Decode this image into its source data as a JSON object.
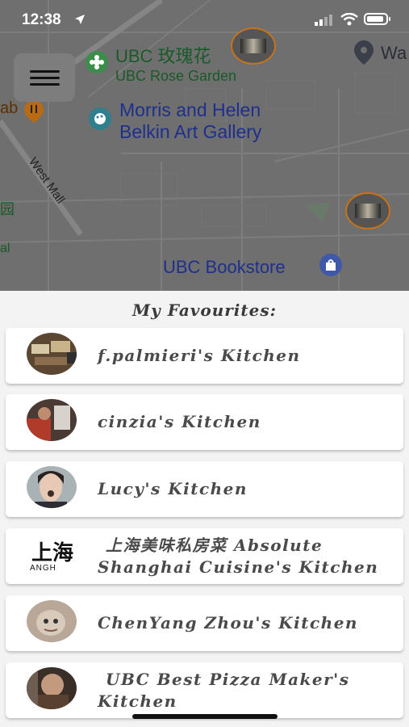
{
  "status_bar": {
    "time": "12:38"
  },
  "map": {
    "pois": {
      "rose_garden_cn": "UBC 玫瑰花",
      "rose_garden_en": "UBC Rose Garden",
      "gallery_line1": "Morris and Helen",
      "gallery_line2": "Belkin Art Gallery",
      "bookstore": "UBC Bookstore",
      "partial_right": "Wa",
      "partial_left_top": "ab",
      "partial_left_cn": "园",
      "partial_left_al": "al"
    },
    "road": "West Mall",
    "icons": {
      "menu": "hamburger-menu-icon",
      "rose_garden": "flower-pin-icon",
      "gallery": "palette-pin-icon",
      "bookstore": "shopping-bag-pin-icon",
      "pub": "food-pin-icon",
      "location": "map-pin-icon"
    }
  },
  "favourites": {
    "title": "My Favourites:",
    "items": [
      {
        "name": "f.palmieri's Kitchen"
      },
      {
        "name": "cinzia's Kitchen"
      },
      {
        "name": "Lucy's Kitchen"
      },
      {
        "name": "上海美味私房菜 Absolute Shanghai Cuisine's Kitchen",
        "avatar_text": "上海",
        "avatar_subtext": "ANGH"
      },
      {
        "name": "ChenYang Zhou's Kitchen"
      },
      {
        "name": "UBC Best Pizza Maker's Kitchen"
      }
    ]
  }
}
